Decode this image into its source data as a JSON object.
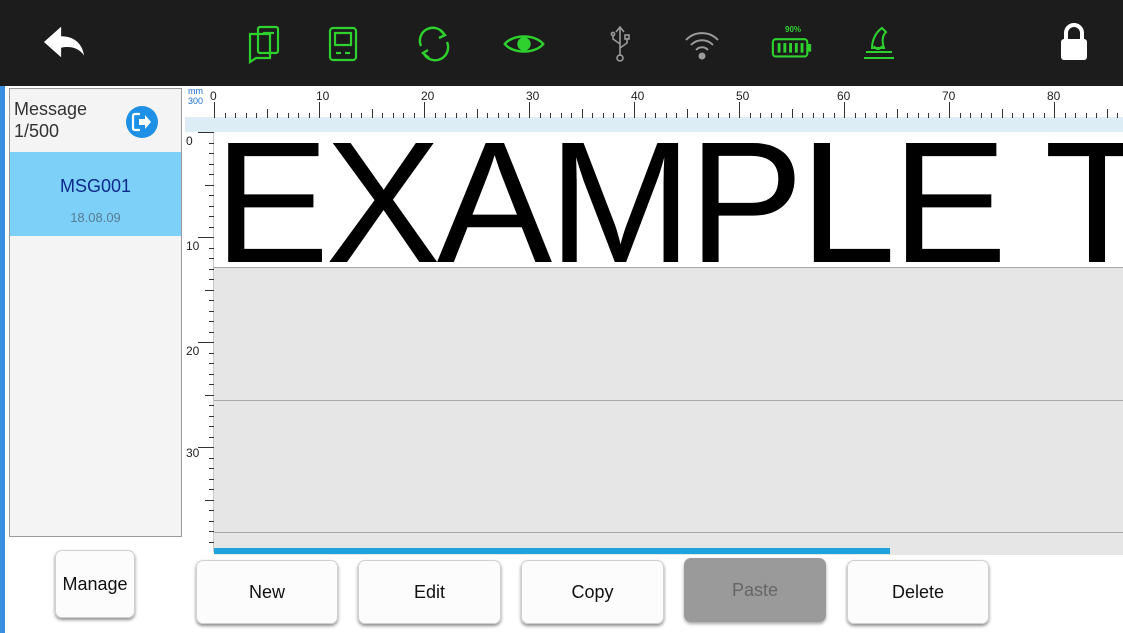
{
  "toolbar": {
    "icons": [
      "back-arrow-icon",
      "documents-icon",
      "printer-head-icon",
      "sync-icon",
      "eye-icon",
      "usb-icon",
      "wifi-icon",
      "battery-icon",
      "ink-pour-icon",
      "lock-icon"
    ],
    "battery_label": "90%",
    "accent_color": "#2fd12f"
  },
  "sidebar": {
    "title": "Message",
    "count": "1/500",
    "messages": [
      {
        "name": "MSG001",
        "date": "18.08.09"
      }
    ]
  },
  "ruler": {
    "unit": "mm",
    "resolution": "300",
    "top_labels": [
      "0",
      "10",
      "20",
      "30",
      "40",
      "50",
      "60",
      "70",
      "80"
    ],
    "left_labels": [
      "0",
      "10",
      "20",
      "30"
    ]
  },
  "canvas": {
    "text": "EXAMPLE T"
  },
  "buttons": {
    "manage": "Manage",
    "new": "New",
    "edit": "Edit",
    "copy": "Copy",
    "paste": "Paste",
    "delete": "Delete"
  }
}
